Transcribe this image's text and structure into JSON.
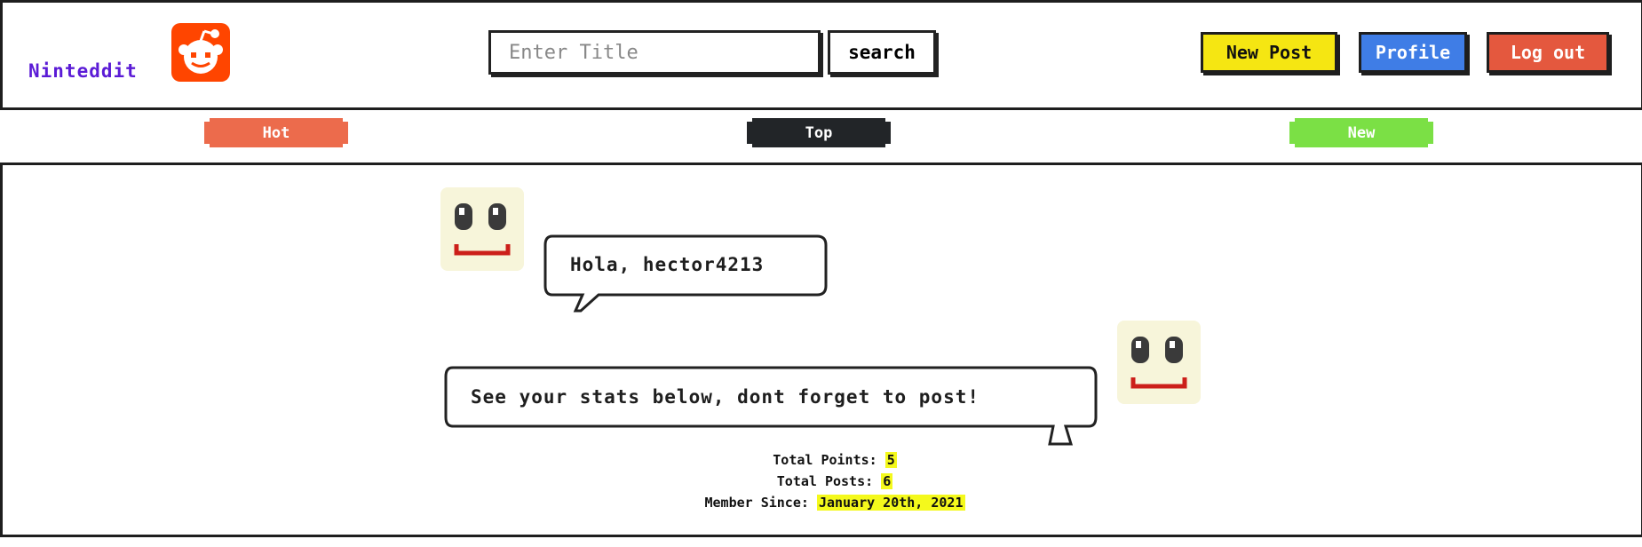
{
  "header": {
    "brand": "Ninteddit",
    "search_placeholder": "Enter Title",
    "search_button": "search",
    "new_post": "New Post",
    "profile": "Profile",
    "logout": "Log out"
  },
  "tabs": [
    {
      "label": "Hot",
      "color": "#ec6b4c"
    },
    {
      "label": "Top",
      "color": "#222528"
    },
    {
      "label": "New",
      "color": "#7be045"
    }
  ],
  "main": {
    "greeting": "Hola, hector4213",
    "message": "See your stats below, dont forget to post!",
    "stats": {
      "points_label": "Total Points:",
      "points_value": "5",
      "posts_label": "Total Posts:",
      "posts_value": "6",
      "member_label": "Member Since:",
      "member_value": "January 20th, 2021"
    }
  },
  "colors": {
    "brand": "#5b1bd6",
    "logo": "#ff4500",
    "new_post": "#f5e612",
    "profile": "#3f7de6",
    "logout": "#e4583e",
    "highlight": "#f4f91c"
  },
  "icons": {
    "logo": "reddit-alien-icon",
    "avatar": "smiley-face-icon"
  }
}
